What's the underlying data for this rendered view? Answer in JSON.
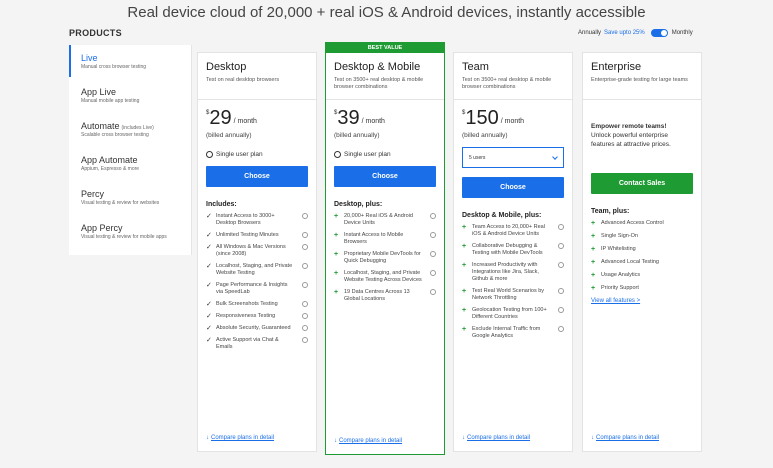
{
  "headline": "Real device cloud of 20,000 + real iOS & Android devices, instantly accessible",
  "products_label": "PRODUCTS",
  "billing": {
    "annually": "Annually",
    "save": "Save upto 25%",
    "monthly": "Monthly"
  },
  "sidebar": [
    {
      "name": "Live",
      "desc": "Manual cross browser testing",
      "includes": ""
    },
    {
      "name": "App Live",
      "desc": "Manual mobile app testing",
      "includes": ""
    },
    {
      "name": "Automate",
      "desc": "Scalable cross browser testing",
      "includes": "(includes Live)"
    },
    {
      "name": "App Automate",
      "desc": "Appium, Espresso & more",
      "includes": ""
    },
    {
      "name": "Percy",
      "desc": "Visual testing & review for websites",
      "includes": ""
    },
    {
      "name": "App Percy",
      "desc": "Visual testing & review for mobile apps",
      "includes": ""
    }
  ],
  "cards": [
    {
      "title": "Desktop",
      "sub": "Test on real desktop browsers",
      "currency": "$",
      "price": "29",
      "per": "/ month",
      "billed": "(billed annually)",
      "plan": "Single user plan",
      "cta": "Choose",
      "includes_title": "Includes:",
      "features": [
        "Instant Access to 3000+ Desktop Browsers",
        "Unlimited Testing Minutes",
        "All Windows & Mac Versions (since 2008)",
        "Localhost, Staging, and Private Website Testing",
        "Page Performance & Insights via SpeedLab",
        "Bulk Screenshots Testing",
        "Responsiveness Testing",
        "Absolute Security, Guaranteed",
        "Active Support via Chat & Emails"
      ],
      "compare": "Compare plans in detail"
    },
    {
      "badge": "BEST VALUE",
      "title": "Desktop & Mobile",
      "sub": "Test on 3500+ real desktop & mobile browser combinations",
      "currency": "$",
      "price": "39",
      "per": "/ month",
      "billed": "(billed annually)",
      "plan": "Single user plan",
      "cta": "Choose",
      "includes_title": "Desktop, plus:",
      "features": [
        "20,000+ Real iOS & Android Device Units",
        "Instant Access to Mobile Browsers",
        "Proprietary Mobile DevTools for Quick Debugging",
        "Localhost, Staging, and Private Website Testing Across Devices",
        "19 Data Centres Across 13 Global Locations"
      ],
      "compare": "Compare plans in detail"
    },
    {
      "title": "Team",
      "sub": "Test on 3500+ real desktop & mobile browser combinations",
      "currency": "$",
      "price": "150",
      "per": "/ month",
      "billed": "(billed annually)",
      "select_value": "5 users",
      "cta": "Choose",
      "includes_title": "Desktop & Mobile, plus:",
      "features": [
        "Team Access to 20,000+ Real iOS & Android Device Units",
        "Collaborative Debugging & Testing with Mobile DevTools",
        "Increased Productivity with Integrations like Jira, Slack, Github & more",
        "Test Real World Scenarios by Network Throttling",
        "Geolocation Testing from 100+ Different Countries",
        "Exclude Internal Traffic from Google Analytics"
      ],
      "compare": "Compare plans in detail"
    },
    {
      "title": "Enterprise",
      "sub": "Enterprise-grade testing for large teams",
      "pitch_bold": "Empower remote teams!",
      "pitch": "Unlock powerful enterprise features at attractive prices.",
      "cta": "Contact Sales",
      "includes_title": "Team, plus:",
      "features": [
        "Advanced Access Control",
        "Single Sign-On",
        "IP Whitelisting",
        "Advanced Local Testing",
        "Usage Analytics",
        "Priority Support"
      ],
      "view_all": "View all features >",
      "compare": "Compare plans in detail"
    }
  ],
  "colors": {
    "accent": "#1a6fe8",
    "featured": "#1e9b33"
  }
}
